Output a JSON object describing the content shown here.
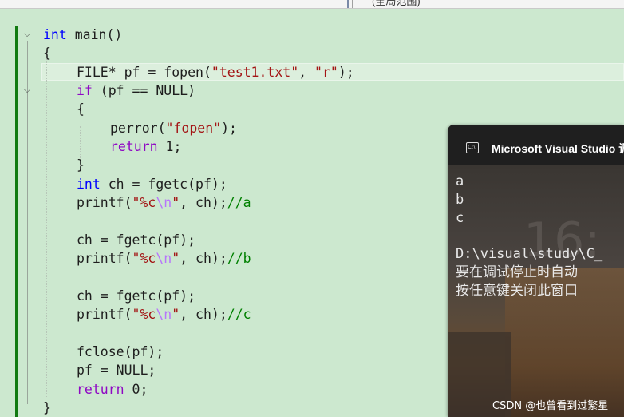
{
  "topbar": {
    "tab_text": "(全局范围)"
  },
  "editor": {
    "lines": [
      "int main()",
      "{",
      "FILE* pf = fopen(",
      "if (pf == NULL)",
      "{",
      "perror(",
      "return 1;",
      "}"
    ],
    "code": {
      "l1_kw": "int",
      "l1_rest": " main()",
      "l2": "{",
      "l3_a": "FILE* pf = fopen(",
      "l3_s1": "\"test1.txt\"",
      "l3_b": ", ",
      "l3_s2": "\"r\"",
      "l3_c": ");",
      "l4_kw": "if",
      "l4_rest": " (pf == NULL)",
      "l5": "{",
      "l6_a": "perror(",
      "l6_s": "\"fopen\"",
      "l6_b": ");",
      "l7_kw": "return",
      "l7_rest": " 1;",
      "l8": "}",
      "l9_kw": "int",
      "l9_rest": " ch = fgetc(pf);",
      "l10_a": "printf(",
      "l10_s1": "\"%c",
      "l10_esc": "\\n",
      "l10_s2": "\"",
      "l10_b": ", ch);",
      "l10_cm": "//a",
      "l12": "ch = fgetc(pf);",
      "l13_a": "printf(",
      "l13_s1": "\"%c",
      "l13_esc": "\\n",
      "l13_s2": "\"",
      "l13_b": ", ch);",
      "l13_cm": "//b",
      "l15": "ch = fgetc(pf);",
      "l16_a": "printf(",
      "l16_s1": "\"%c",
      "l16_esc": "\\n",
      "l16_s2": "\"",
      "l16_b": ", ch);",
      "l16_cm": "//c",
      "l18": "fclose(pf);",
      "l19": "pf = NULL;",
      "l20_kw": "return",
      "l20_rest": " 0;",
      "l21": "}"
    }
  },
  "console": {
    "title": "Microsoft Visual Studio 调",
    "icon_label": "C:\\",
    "bg_clock": "16:",
    "output": [
      "a",
      "b",
      "c",
      "",
      "D:\\visual\\study\\C_",
      "要在调试停止时自动",
      "按任意键关闭此窗口"
    ]
  },
  "watermark": "CSDN @也曾看到过繁星",
  "colors": {
    "editor_bg": "#cce8cf",
    "keyword": "#0000ff",
    "control_keyword": "#8f08c4",
    "string": "#a31515",
    "comment": "#008000",
    "change_bar": "#117a11"
  }
}
